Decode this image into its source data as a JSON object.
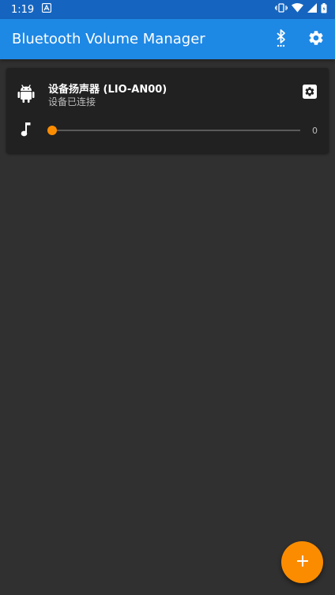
{
  "status_bar": {
    "time": "1:19"
  },
  "app_bar": {
    "title": "Bluetooth Volume Manager"
  },
  "devices": [
    {
      "name": "设备扬声器 (LIO-AN00)",
      "status": "设备已连接",
      "volume": {
        "value_label": "0",
        "level": 0
      }
    }
  ],
  "colors": {
    "status_bar": "#1565c0",
    "app_bar": "#1e88e5",
    "accent": "#fb8c00",
    "background": "#303030",
    "card": "#212121"
  },
  "icons": {
    "status_left": [
      "notification-a-icon"
    ],
    "status_right": [
      "vibrate-icon",
      "wifi-icon",
      "cell-signal-icon",
      "battery-icon"
    ],
    "app_actions": [
      "bluetooth-searching-icon",
      "gear-icon"
    ],
    "device": "android-icon",
    "device_settings": "settings-box-icon",
    "volume": "music-note-icon",
    "fab": "plus-icon"
  }
}
